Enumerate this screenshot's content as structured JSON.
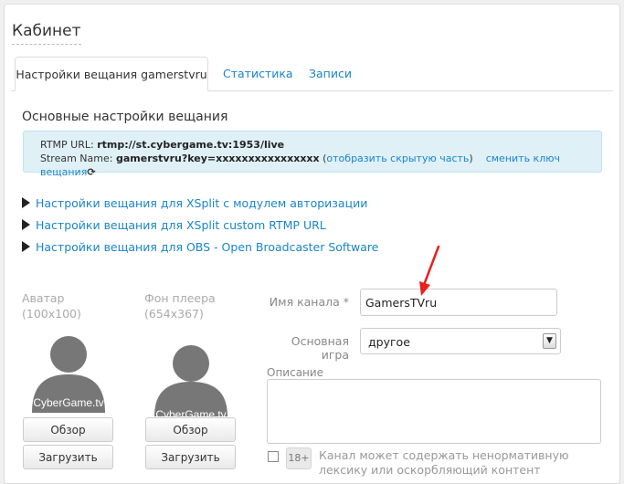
{
  "page": {
    "title": "Кабинет"
  },
  "tabs": [
    {
      "label": "Настройки вещания gamerstvru",
      "active": true
    },
    {
      "label": "Статистика",
      "active": false
    },
    {
      "label": "Записи",
      "active": false
    }
  ],
  "section": {
    "title": "Основные настройки вещания"
  },
  "info": {
    "rtmp_label": "RTMP URL:",
    "rtmp_value": "rtmp://st.cybergame.tv:1953/live",
    "stream_label": "Stream Name:",
    "stream_value": "gamerstvru?key=xxxxxxxxxxxxxxxx",
    "paren_open": "(",
    "show_hidden": "отобразить скрытую часть",
    "paren_close": ")",
    "change_key": "сменить ключ вещания",
    "change_key_icon": "refresh-icon"
  },
  "expanders": [
    "Настройки вещания для XSplit с модулем авторизации",
    "Настройки вещания для XSplit custom RTMP URL",
    "Настройки вещания для OBS - Open Broadcaster Software"
  ],
  "avatar": {
    "label": "Аватар",
    "size": "(100x100)",
    "watermark": "CyberGame.tv",
    "browse": "Обзор",
    "upload": "Загрузить"
  },
  "background": {
    "label": "Фон плеера",
    "size": "(654x367)",
    "watermark": "CyberGame.tv",
    "browse": "Обзор",
    "upload": "Загрузить"
  },
  "form": {
    "channel_label": "Имя канала *",
    "channel_value": "GamersTVru",
    "game_label": "Основная игра",
    "game_value": "другое",
    "description_label": "Описание",
    "description_value": "",
    "adult_badge": "18+",
    "adult_text": "Канал может содержать ненормативную лексику или оскорбляющий контент",
    "adult_checked": false
  },
  "colors": {
    "link": "#1a85c9",
    "infobox_bg": "#dff0f7",
    "arrow": "#e8211d",
    "silhouette": "#777777"
  }
}
